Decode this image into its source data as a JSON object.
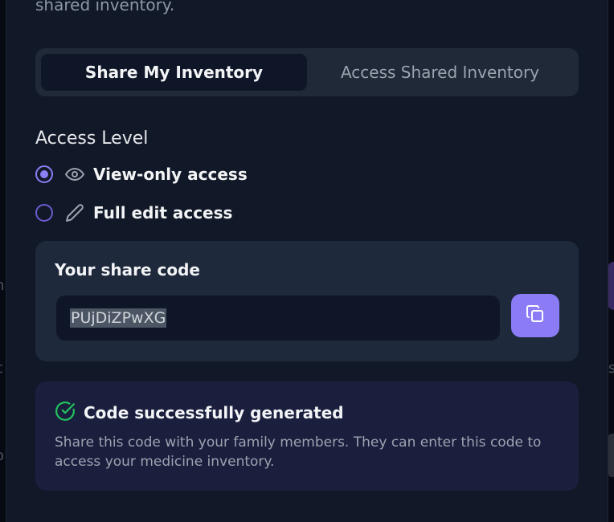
{
  "header": {
    "subtitle_fragment": "shared inventory."
  },
  "tabs": [
    {
      "label": "Share My Inventory",
      "active": true
    },
    {
      "label": "Access Shared Inventory",
      "active": false
    }
  ],
  "access": {
    "label": "Access Level",
    "options": [
      {
        "label": "View-only access",
        "icon": "eye-icon",
        "checked": true
      },
      {
        "label": "Full edit access",
        "icon": "pencil-icon",
        "checked": false
      }
    ]
  },
  "share_code": {
    "title": "Your share code",
    "value": "PUjDiZPwXG",
    "copy_icon": "copy-icon"
  },
  "success": {
    "icon": "check-circle-icon",
    "title": "Code successfully generated",
    "description": "Share this code with your family members. They can enter this code to access your medicine inventory."
  },
  "colors": {
    "accent": "#8b7cf6",
    "success": "#22c55e",
    "panel": "#111827",
    "card": "#1e293b"
  }
}
